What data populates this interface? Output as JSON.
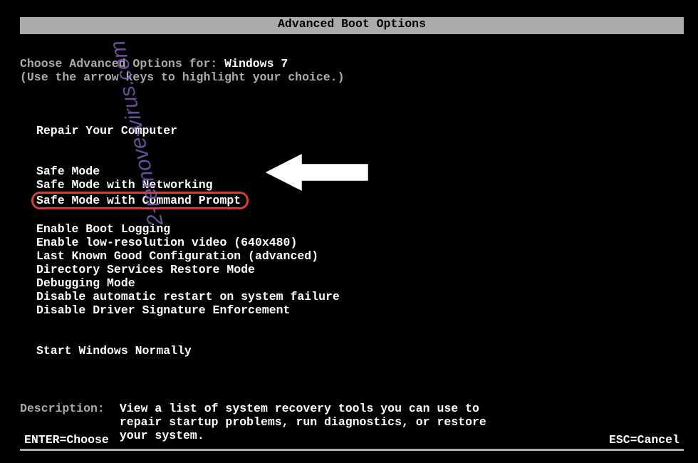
{
  "title": "Advanced Boot Options",
  "choose_prefix": "Choose Advanced Options for: ",
  "os_name": "Windows 7",
  "instructions": "(Use the arrow keys to highlight your choice.)",
  "menu": {
    "group1": [
      "Repair Your Computer"
    ],
    "group2": [
      "Safe Mode",
      "Safe Mode with Networking",
      "Safe Mode with Command Prompt"
    ],
    "group3": [
      "Enable Boot Logging",
      "Enable low-resolution video (640x480)",
      "Last Known Good Configuration (advanced)",
      "Directory Services Restore Mode",
      "Debugging Mode",
      "Disable automatic restart on system failure",
      "Disable Driver Signature Enforcement"
    ],
    "group4": [
      "Start Windows Normally"
    ]
  },
  "highlighted_item": "Safe Mode with Command Prompt",
  "description": {
    "label": "Description:",
    "text": "View a list of system recovery tools you can use to repair startup problems, run diagnostics, or restore your system."
  },
  "footer": {
    "left": "ENTER=Choose",
    "right": "ESC=Cancel"
  },
  "watermark_text": "2-remove-virus.com",
  "colors": {
    "bg": "#000000",
    "text_dim": "#aaaaaa",
    "text_bright": "#ffffff",
    "highlight_border": "#d04038",
    "watermark": "#7a5fb0"
  }
}
